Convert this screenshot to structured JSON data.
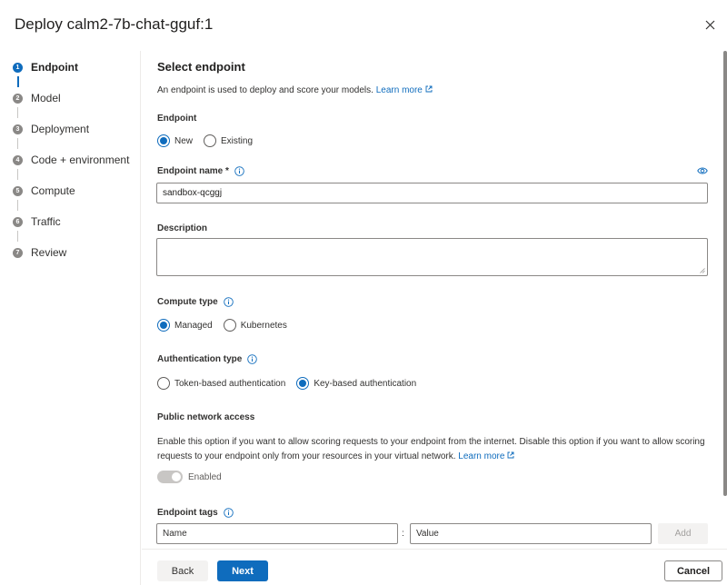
{
  "dialog": {
    "title": "Deploy calm2-7b-chat-gguf:1"
  },
  "stepper": {
    "steps": [
      {
        "num": "1",
        "label": "Endpoint"
      },
      {
        "num": "2",
        "label": "Model"
      },
      {
        "num": "3",
        "label": "Deployment"
      },
      {
        "num": "4",
        "label": "Code + environment"
      },
      {
        "num": "5",
        "label": "Compute"
      },
      {
        "num": "6",
        "label": "Traffic"
      },
      {
        "num": "7",
        "label": "Review"
      }
    ]
  },
  "endpoint": {
    "section_title": "Select endpoint",
    "description": "An endpoint is used to deploy and score your models.",
    "learn_more": "Learn more",
    "endpoint_label": "Endpoint",
    "endpoint_options": [
      "New",
      "Existing"
    ],
    "name_label": "Endpoint name",
    "required_mark": "*",
    "name_value": "sandbox-qcggj",
    "description_label": "Description",
    "compute_label": "Compute type",
    "compute_options": [
      "Managed",
      "Kubernetes"
    ],
    "auth_label": "Authentication type",
    "auth_options": [
      "Token-based authentication",
      "Key-based authentication"
    ],
    "network_label": "Public network access",
    "network_text_1": "Enable this option if you want to allow scoring requests to your endpoint from the internet. Disable this option if you want to allow scoring",
    "network_text_2": "requests to your endpoint only from your resources in your virtual network.",
    "network_learn_more": "Learn more",
    "toggle_label": "Enabled",
    "tags_label": "Endpoint tags",
    "tag_name_placeholder": "Name",
    "tag_value_placeholder": "Value",
    "tag_separator": ":",
    "add_label": "Add"
  },
  "footer": {
    "back": "Back",
    "next": "Next",
    "cancel": "Cancel"
  },
  "colors": {
    "accent": "#0f6cbd",
    "disabled": "#c8c6c4"
  }
}
